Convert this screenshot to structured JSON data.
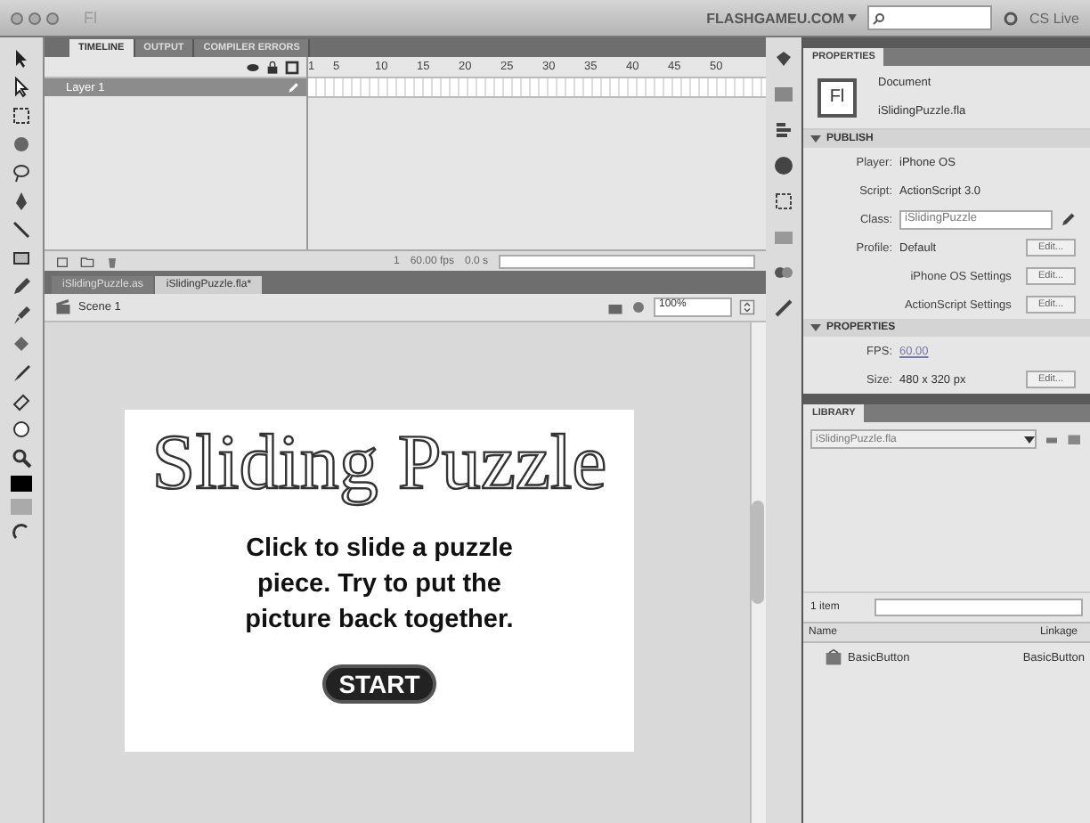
{
  "window": {
    "app_badge": "Fl",
    "workspace": "FLASHGAMEU.COM",
    "cs_live": "CS Live"
  },
  "timeline": {
    "tabs": [
      {
        "label": "TIMELINE",
        "selected": true
      },
      {
        "label": "OUTPUT",
        "selected": false
      },
      {
        "label": "COMPILER ERRORS",
        "selected": false
      }
    ],
    "frame_numbers": [
      "1",
      "5",
      "10",
      "15",
      "20",
      "25",
      "30",
      "35",
      "40",
      "45",
      "50"
    ],
    "layers": [
      {
        "name": "Layer 1",
        "selected": true
      }
    ],
    "status": [
      "1",
      "60.00 fps",
      "0.0 s"
    ]
  },
  "document_tabs": [
    {
      "label": "iSlidingPuzzle.as",
      "selected": false
    },
    {
      "label": "iSlidingPuzzle.fla*",
      "selected": true
    }
  ],
  "scene": {
    "label": "Scene 1",
    "zoom": "100%"
  },
  "stage": {
    "title": "Sliding Puzzle",
    "instructions": "Click to slide a puzzle piece. Try to put the picture back together.",
    "button": "START"
  },
  "properties": {
    "tab": "PROPERTIES",
    "doc_icon": "Fl",
    "doc_type": "Document",
    "file": "iSlidingPuzzle.fla",
    "sections": [
      {
        "title": "PUBLISH",
        "expanded": true,
        "rows": [
          {
            "kind": "text",
            "label": "Player:",
            "value": "iPhone OS"
          },
          {
            "kind": "text",
            "label": "Script:",
            "value": "ActionScript 3.0"
          },
          {
            "kind": "field",
            "label": "Class:",
            "value": "iSlidingPuzzle"
          },
          {
            "kind": "button",
            "label": "Profile:",
            "value": "Default",
            "button": "Edit..."
          },
          {
            "kind": "button",
            "label": "iPhone OS Settings",
            "button": "Edit..."
          },
          {
            "kind": "button",
            "label": "ActionScript Settings",
            "button": "Edit..."
          }
        ]
      },
      {
        "title": "PROPERTIES",
        "expanded": true,
        "rows": [
          {
            "kind": "link",
            "label": "FPS:",
            "value": "60.00"
          },
          {
            "kind": "button",
            "label": "Size:",
            "value": "480 x 320 px",
            "button": "Edit..."
          }
        ]
      }
    ]
  },
  "library": {
    "tab": "LIBRARY",
    "file": "iSlidingPuzzle.fla",
    "count": "1 item",
    "columns": [
      "Name",
      "Linkage"
    ],
    "items": [
      {
        "name": "BasicButton",
        "linkage": "BasicButton"
      }
    ]
  }
}
